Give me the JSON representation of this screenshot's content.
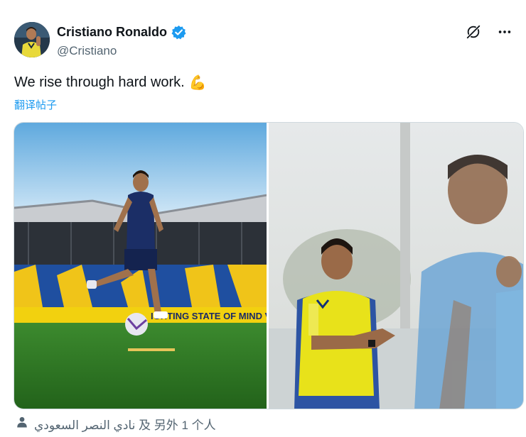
{
  "author": {
    "name": "Cristiano Ronaldo",
    "handle": "@Cristiano",
    "verified": true,
    "badge_color": "#1d9bf0"
  },
  "header_icons": [
    "grok-icon",
    "more-icon"
  ],
  "post": {
    "text": "We rise through hard work.",
    "emoji": "💪",
    "translate_label": "翻译帖子"
  },
  "media": {
    "left_photo": {
      "banner_text": "IGHTING STATE OF MIND V"
    },
    "right_photo": {}
  },
  "tagged": {
    "text": "نادي النصر السعودي 及 另外 1 个人",
    "icon": "person-icon"
  },
  "colors": {
    "link": "#1d9bf0",
    "secondary_text": "#536471",
    "primary_text": "#0f1419"
  }
}
